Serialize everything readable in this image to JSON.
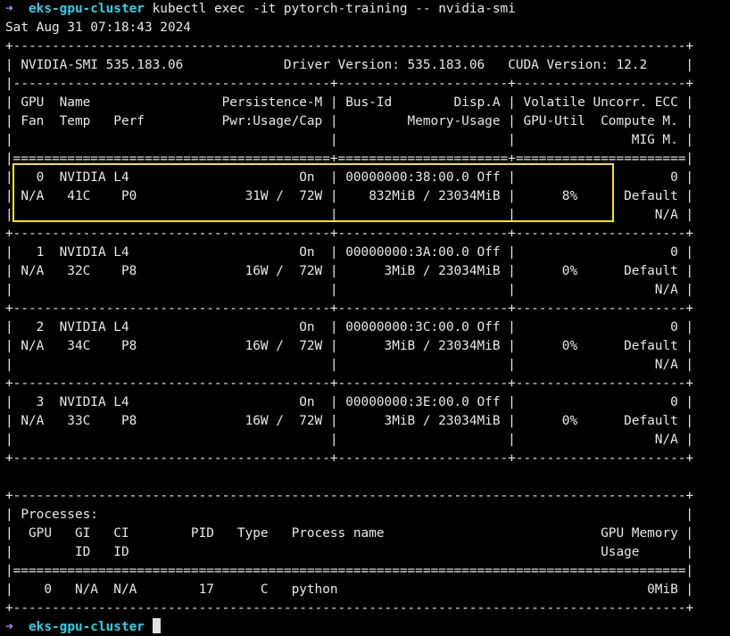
{
  "prompt": {
    "arrow": "➜",
    "host": "eks-gpu-cluster",
    "command": "kubectl exec -it pytorch-training -- nvidia-smi"
  },
  "output": [
    "Sat Aug 31 07:18:43 2024",
    "+---------------------------------------------------------------------------------------+",
    "| NVIDIA-SMI 535.183.06             Driver Version: 535.183.06   CUDA Version: 12.2     |",
    "|-----------------------------------------+----------------------+----------------------+",
    "| GPU  Name                 Persistence-M | Bus-Id        Disp.A | Volatile Uncorr. ECC |",
    "| Fan  Temp   Perf          Pwr:Usage/Cap |         Memory-Usage | GPU-Util  Compute M. |",
    "|                                         |                      |               MIG M. |",
    "|=========================================+======================+======================|",
    "|   0  NVIDIA L4                      On  | 00000000:38:00.0 Off |                    0 |",
    "| N/A   41C    P0              31W /  72W |    832MiB / 23034MiB |      8%      Default |",
    "|                                         |                      |                  N/A |",
    "+-----------------------------------------+----------------------+----------------------+",
    "|   1  NVIDIA L4                      On  | 00000000:3A:00.0 Off |                    0 |",
    "| N/A   32C    P8              16W /  72W |      3MiB / 23034MiB |      0%      Default |",
    "|                                         |                      |                  N/A |",
    "+-----------------------------------------+----------------------+----------------------+",
    "|   2  NVIDIA L4                      On  | 00000000:3C:00.0 Off |                    0 |",
    "| N/A   34C    P8              16W /  72W |      3MiB / 23034MiB |      0%      Default |",
    "|                                         |                      |                  N/A |",
    "+-----------------------------------------+----------------------+----------------------+",
    "|   3  NVIDIA L4                      On  | 00000000:3E:00.0 Off |                    0 |",
    "| N/A   33C    P8              16W /  72W |      3MiB / 23034MiB |      0%      Default |",
    "|                                         |                      |                  N/A |",
    "+-----------------------------------------+----------------------+----------------------+",
    "",
    "+---------------------------------------------------------------------------------------+",
    "| Processes:                                                                            |",
    "|  GPU   GI   CI        PID   Type   Process name                            GPU Memory |",
    "|        ID   ID                                                             Usage      |",
    "|=======================================================================================|",
    "|    0   N/A  N/A        17      C   python                                        0MiB |",
    "+---------------------------------------------------------------------------------------+"
  ],
  "final_prompt": {
    "arrow": "➜",
    "host": "eks-gpu-cluster"
  },
  "colors": {
    "highlight": "#f5e21b",
    "prompt_arrow": "#b38cff",
    "prompt_host": "#29d3e6"
  }
}
